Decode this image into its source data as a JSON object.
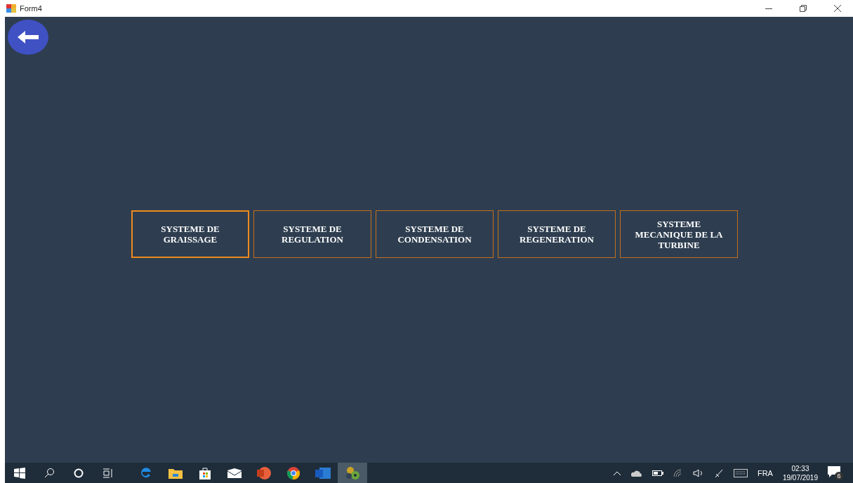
{
  "window": {
    "title": "Form4"
  },
  "buttons": [
    {
      "label": "SYSTEME DE GRAISSAGE",
      "selected": true
    },
    {
      "label": "SYSTEME DE REGULATION",
      "selected": false
    },
    {
      "label": "SYSTEME DE CONDENSATION",
      "selected": false
    },
    {
      "label": "SYSTEME DE REGENERATION",
      "selected": false
    },
    {
      "label": "SYSTEME MECANIQUE DE LA TURBINE",
      "selected": false
    }
  ],
  "taskbar": {
    "apps": [
      {
        "kind": "start",
        "selected": false
      },
      {
        "kind": "search",
        "selected": false
      },
      {
        "kind": "cortana",
        "selected": false
      },
      {
        "kind": "taskview",
        "selected": false
      },
      {
        "kind": "edge",
        "selected": false
      },
      {
        "kind": "folder",
        "selected": false
      },
      {
        "kind": "store",
        "selected": false
      },
      {
        "kind": "mail",
        "selected": false
      },
      {
        "kind": "powerpoint",
        "selected": false
      },
      {
        "kind": "chrome",
        "selected": false
      },
      {
        "kind": "word",
        "selected": false
      },
      {
        "kind": "gears",
        "selected": true
      }
    ],
    "language": "FRA",
    "time": "02:33",
    "date": "19/07/2019",
    "notifications": "6"
  }
}
